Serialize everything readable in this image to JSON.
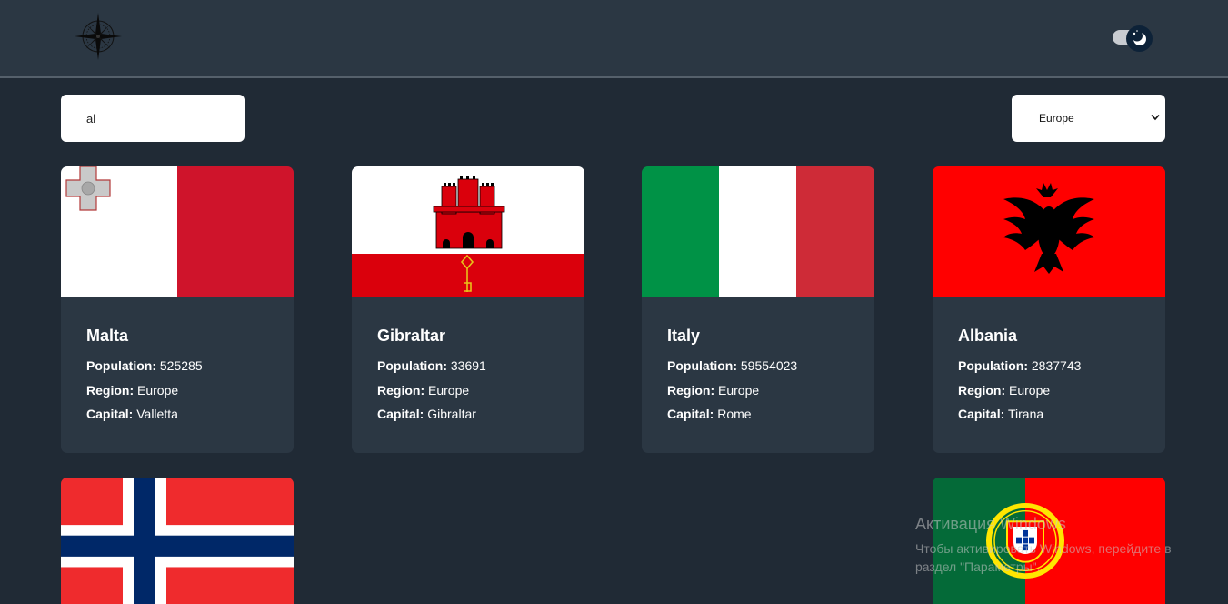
{
  "header": {
    "logo_icon": "compass-rose-icon",
    "theme_toggle_icon": "moon-icon",
    "theme_toggle_state": "dark"
  },
  "search": {
    "value": "al",
    "placeholder": ""
  },
  "region_filter": {
    "selected": "Europe"
  },
  "countries": [
    {
      "name": "Malta",
      "flag": "malta-flag",
      "population_label": "Population:",
      "population": "525285",
      "region_label": "Region:",
      "region": "Europe",
      "capital_label": "Capital:",
      "capital": "Valletta"
    },
    {
      "name": "Gibraltar",
      "flag": "gibraltar-flag",
      "population_label": "Population:",
      "population": "33691",
      "region_label": "Region:",
      "region": "Europe",
      "capital_label": "Capital:",
      "capital": "Gibraltar"
    },
    {
      "name": "Italy",
      "flag": "italy-flag",
      "population_label": "Population:",
      "population": "59554023",
      "region_label": "Region:",
      "region": "Europe",
      "capital_label": "Capital:",
      "capital": "Rome"
    },
    {
      "name": "Albania",
      "flag": "albania-flag",
      "population_label": "Population:",
      "population": "2837743",
      "region_label": "Region:",
      "region": "Europe",
      "capital_label": "Capital:",
      "capital": "Tirana"
    },
    {
      "name": "",
      "flag": "norway-flag"
    },
    {
      "name": "",
      "flag": "portugal-flag"
    }
  ],
  "watermark": {
    "title": "Активация Windows",
    "subtitle": "Чтобы активировать Windows, перейдите в раздел \"Параметры\"."
  },
  "colors": {
    "background": "#202a35",
    "card": "#2b3743",
    "header": "#2b3743"
  }
}
